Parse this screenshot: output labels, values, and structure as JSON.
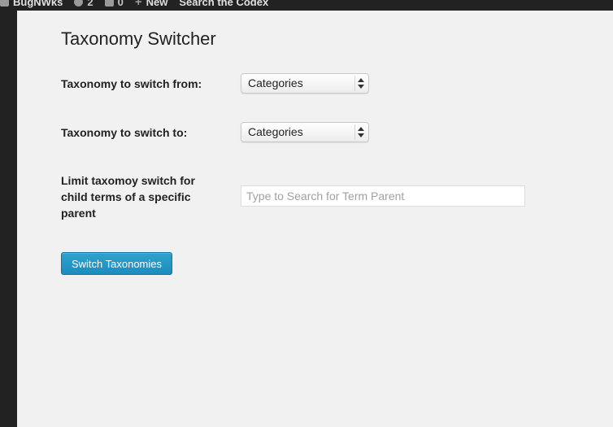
{
  "adminbar": {
    "site_name": "BugNWks",
    "updates_count": "2",
    "comments_count": "0",
    "new_label": "New",
    "search_label": "Search the Codex"
  },
  "page": {
    "title": "Taxonomy Switcher"
  },
  "form": {
    "from_label": "Taxonomy to switch from:",
    "from_value": "Categories",
    "to_label": "Taxonomy to switch to:",
    "to_value": "Categories",
    "parent_label": "Limit taxomoy switch for child terms of a specific parent",
    "parent_placeholder": "Type to Search for Term Parent",
    "submit_label": "Switch Taxonomies"
  },
  "colors": {
    "adminbar_bg": "#222222",
    "content_bg": "#f1f1f1",
    "button_bg": "#2ea2cc"
  }
}
